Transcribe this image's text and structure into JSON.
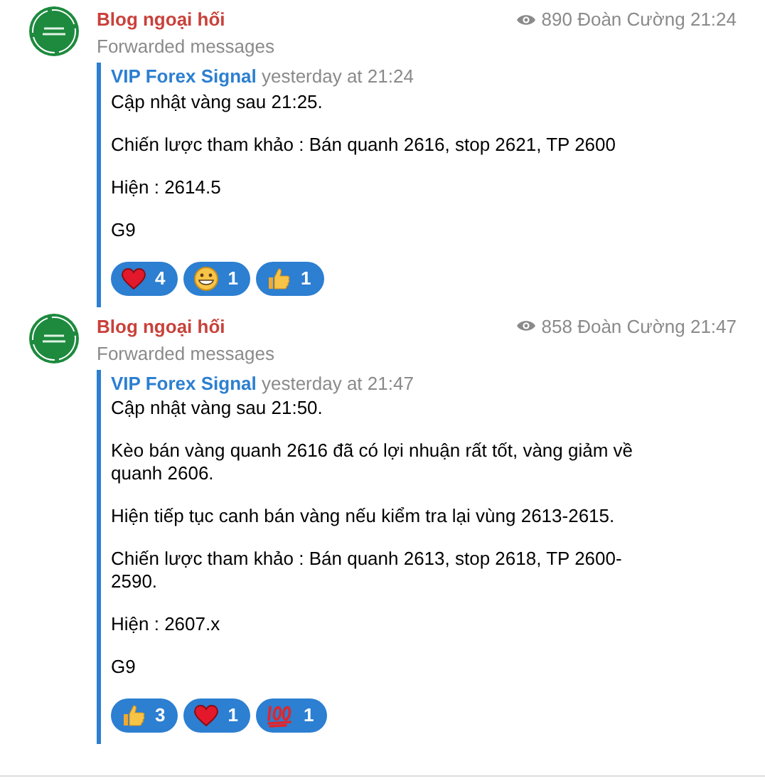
{
  "messages": [
    {
      "channel": "Blog ngoại hối",
      "subtitle": "Forwarded messages",
      "views": "890",
      "author": "Đoàn Cường",
      "time": "21:24",
      "forward_from": "VIP Forex Signal",
      "forward_time": "yesterday at 21:24",
      "paragraphs": [
        "Cập nhật vàng sau 21:25.",
        "Chiến lược tham khảo : Bán quanh 2616, stop 2621, TP 2600",
        "Hiện : 2614.5",
        "G9"
      ],
      "reactions": [
        {
          "kind": "heart",
          "count": "4"
        },
        {
          "kind": "grin",
          "count": "1"
        },
        {
          "kind": "thumbs",
          "count": "1"
        }
      ]
    },
    {
      "channel": "Blog ngoại hối",
      "subtitle": "Forwarded messages",
      "views": "858",
      "author": "Đoàn Cường",
      "time": "21:47",
      "forward_from": "VIP Forex Signal",
      "forward_time": "yesterday at 21:47",
      "paragraphs": [
        "Cập nhật vàng sau 21:50.",
        "Kèo bán vàng quanh 2616 đã có lợi nhuận rất tốt, vàng giảm về quanh 2606.",
        "Hiện tiếp tục canh bán vàng nếu kiểm tra lại vùng 2613-2615.",
        "Chiến lược tham khảo : Bán quanh 2613, stop 2618, TP 2600-2590.",
        "Hiện : 2607.x",
        "G9"
      ],
      "reactions": [
        {
          "kind": "thumbs",
          "count": "3"
        },
        {
          "kind": "heart",
          "count": "1"
        },
        {
          "kind": "hundred",
          "count": "1"
        }
      ]
    }
  ]
}
